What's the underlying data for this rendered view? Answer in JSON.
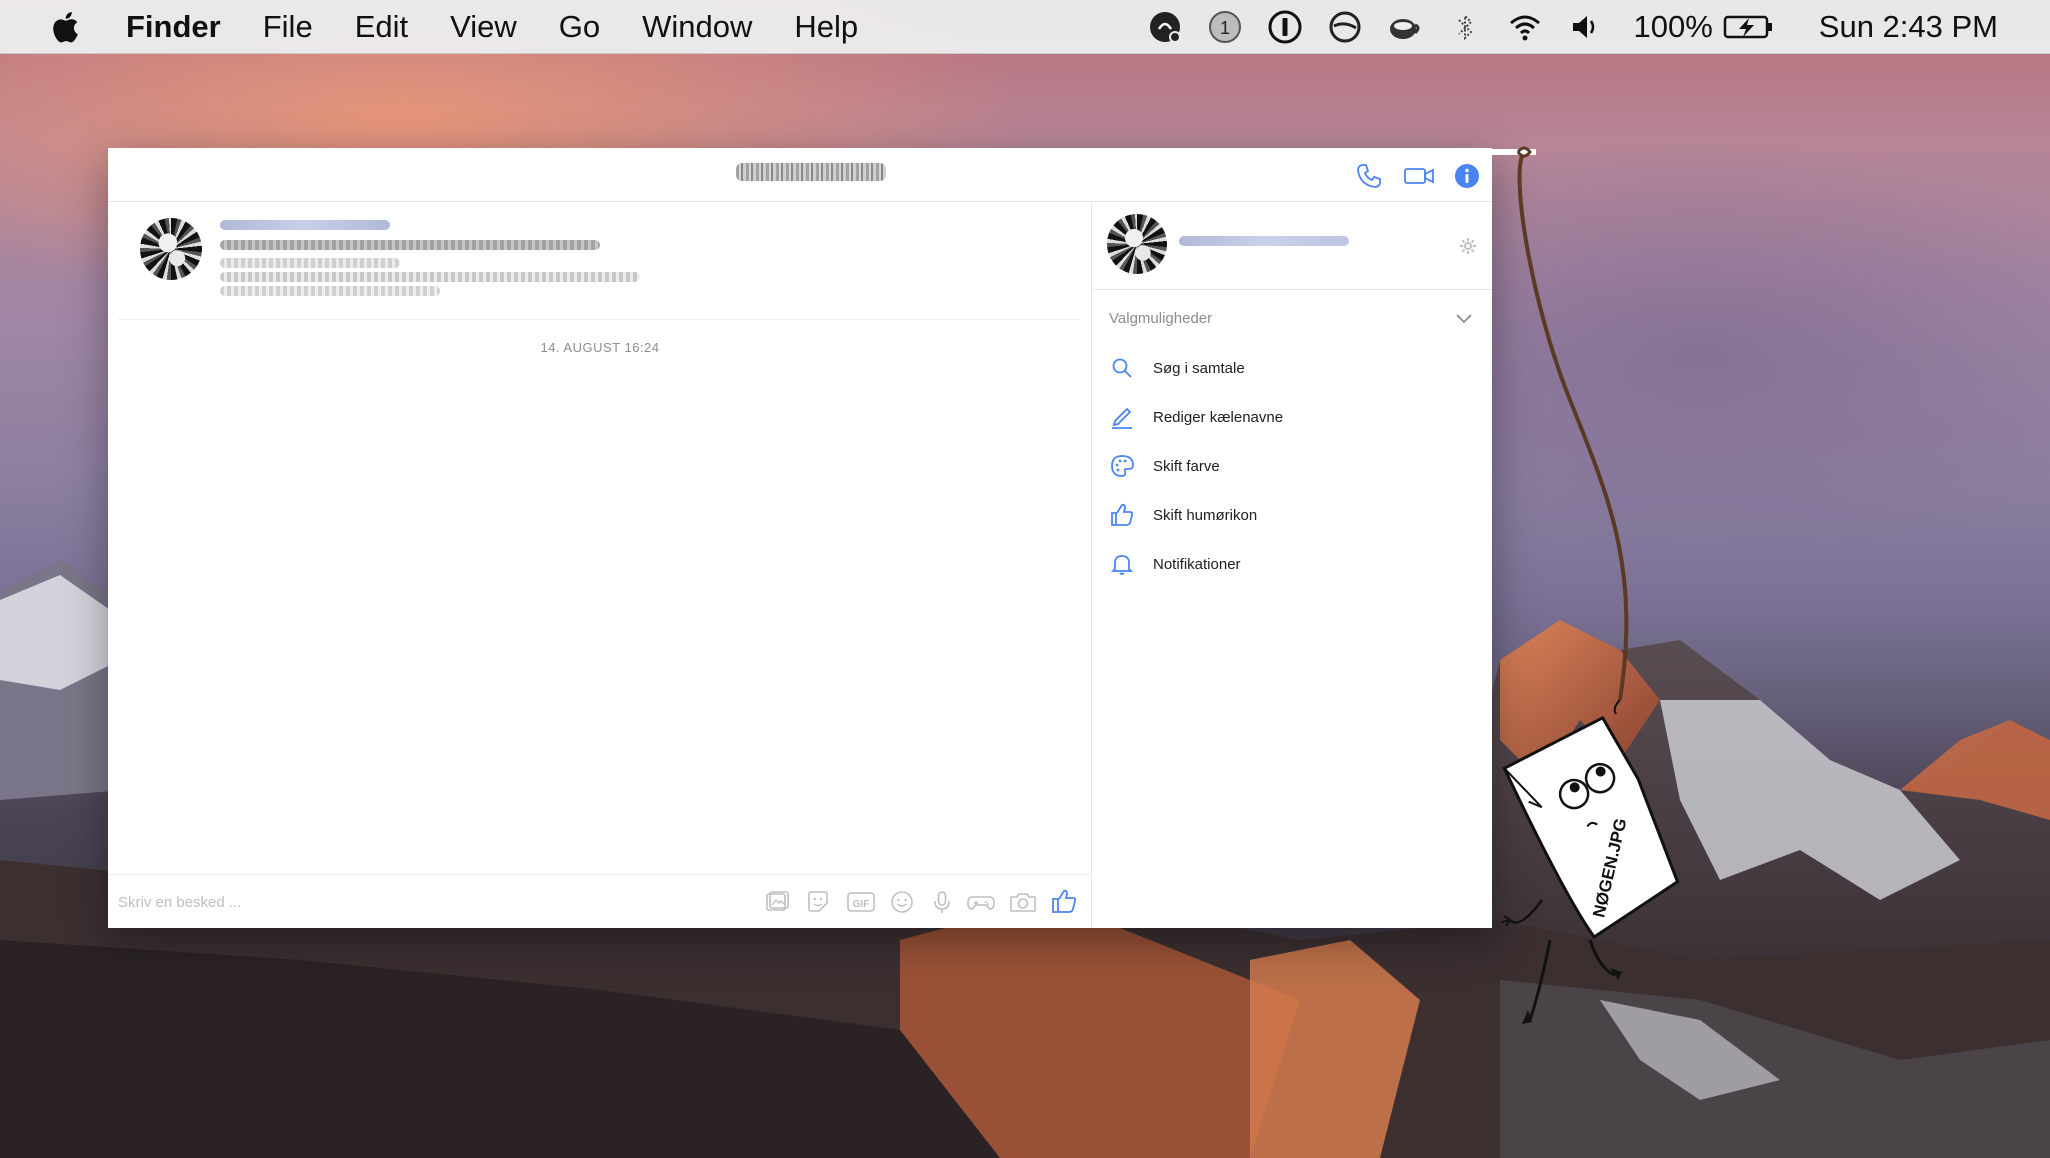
{
  "menubar": {
    "app_name": "Finder",
    "menus": [
      "File",
      "Edit",
      "View",
      "Go",
      "Window",
      "Help"
    ],
    "status_icons": [
      "notification-icon",
      "onepassword-badge-icon",
      "info-circle-icon",
      "slash-circle-icon",
      "coffee-icon",
      "bluetooth-icon",
      "wifi-icon",
      "volume-icon"
    ],
    "badge_count": "1",
    "battery": "100%",
    "clock": "Sun 2:43 PM"
  },
  "window": {
    "header_icons": [
      "phone-icon",
      "video-camera-icon",
      "info-icon"
    ],
    "accent": "#4a84f3"
  },
  "conversation": {
    "date_label": "14. AUGUST 16:24",
    "composer_placeholder": "Skriv en besked ...",
    "composer_icons": [
      "image-icon",
      "sticker-icon",
      "gif-icon",
      "emoji-icon",
      "microphone-icon",
      "game-controller-icon",
      "camera-icon",
      "thumbs-up-icon"
    ]
  },
  "info_panel": {
    "options_title": "Valgmuligheder",
    "options": [
      {
        "icon": "search-icon",
        "label": "Søg i samtale"
      },
      {
        "icon": "pencil-icon",
        "label": "Rediger kælenavne"
      },
      {
        "icon": "palette-icon",
        "label": "Skift farve"
      },
      {
        "icon": "thumbs-up-icon",
        "label": "Skift humørikon"
      },
      {
        "icon": "bell-icon",
        "label": "Notifikationer"
      }
    ]
  },
  "sticker": {
    "text": "NØGEN.JPG"
  }
}
